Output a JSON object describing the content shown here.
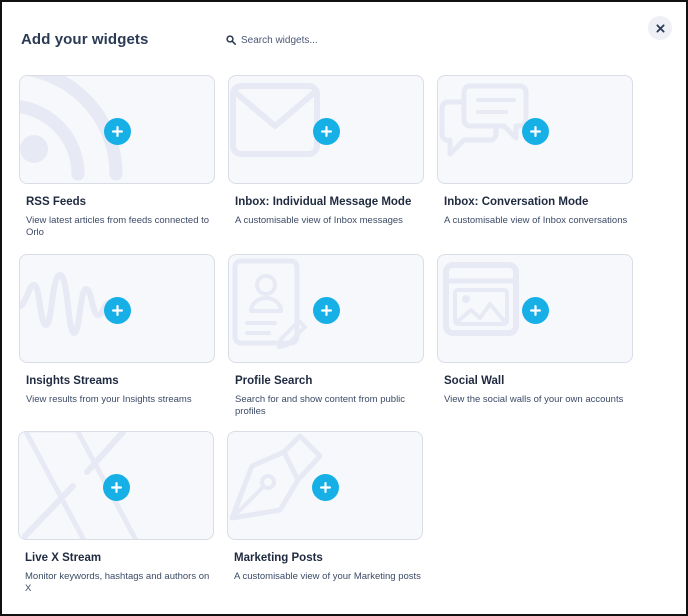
{
  "header": {
    "title": "Add your widgets",
    "search_placeholder": "Search widgets..."
  },
  "widgets": [
    {
      "name": "RSS Feeds",
      "description": "View latest articles from feeds connected to Orlo",
      "icon": "rss-icon"
    },
    {
      "name": "Inbox: Individual Message Mode",
      "description": "A customisable view of Inbox messages",
      "icon": "envelope-icon"
    },
    {
      "name": "Inbox: Conversation Mode",
      "description": "A customisable view of Inbox conversations",
      "icon": "chat-bubbles-icon"
    },
    {
      "name": "Insights Streams",
      "description": "View results from your Insights streams",
      "icon": "waveform-icon"
    },
    {
      "name": "Profile Search",
      "description": "Search for and show content from public profiles",
      "icon": "profile-document-icon"
    },
    {
      "name": "Social Wall",
      "description": "View the social walls of your own accounts",
      "icon": "image-frame-icon"
    },
    {
      "name": "Live X Stream",
      "description": "Monitor keywords, hashtags and authors on X",
      "icon": "x-logo-icon"
    },
    {
      "name": "Marketing Posts",
      "description": "A customisable view of your Marketing posts",
      "icon": "pen-nib-icon"
    }
  ],
  "colors": {
    "accent": "#16b0e6",
    "title": "#2b3a55",
    "card_border": "#d9dde6",
    "card_bg": "#f7f8fb",
    "illustration": "#e7eaf4"
  }
}
